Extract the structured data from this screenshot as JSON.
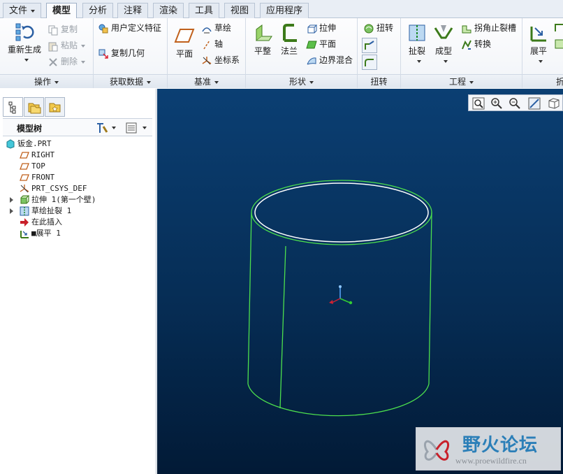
{
  "tabs": [
    {
      "label": "文件",
      "has_menu": true
    },
    {
      "label": "模型",
      "active": true
    },
    {
      "label": "分析"
    },
    {
      "label": "注释"
    },
    {
      "label": "渲染"
    },
    {
      "label": "工具"
    },
    {
      "label": "视图"
    },
    {
      "label": "应用程序"
    }
  ],
  "ribbon": {
    "operations": {
      "footer": "操作",
      "regenerate": "重新生成",
      "copy": "复制",
      "paste": "粘贴",
      "delete": "删除"
    },
    "get_data": {
      "footer": "获取数据",
      "user_defined_feature": "用户定义特征",
      "copy_geometry": "复制几何"
    },
    "datum": {
      "footer": "基准",
      "plane": "平面",
      "sketch": "草绘",
      "axis": "轴",
      "csys": "坐标系"
    },
    "shapes": {
      "footer": "形状",
      "flat": "平整",
      "flange": "法兰",
      "extrude": "拉伸",
      "planar": "平面",
      "boundary_blend": "边界混合"
    },
    "twist": {
      "footer": "扭转",
      "twist": "扭转"
    },
    "engineering": {
      "footer": "工程",
      "rip": "扯裂",
      "form": "成型",
      "corner_relief": "拐角止裂槽",
      "convert": "转换"
    },
    "bends": {
      "footer": "折",
      "unbend": "展平"
    }
  },
  "model_tree": {
    "title": "模型树",
    "items": [
      {
        "label": "钣金.PRT",
        "icon": "part-icon"
      },
      {
        "label": "RIGHT",
        "icon": "datum-plane-icon"
      },
      {
        "label": "TOP",
        "icon": "datum-plane-icon"
      },
      {
        "label": "FRONT",
        "icon": "datum-plane-icon"
      },
      {
        "label": "PRT_CSYS_DEF",
        "icon": "csys-icon"
      },
      {
        "label": "拉伸 1(第一个壁)",
        "icon": "extrude-wall-icon",
        "expandable": true
      },
      {
        "label": "草绘扯裂 1",
        "icon": "sketched-rip-icon",
        "expandable": true
      },
      {
        "label": "在此插入",
        "icon": "insert-here-arrow-icon"
      },
      {
        "label": "■展平 1",
        "icon": "unbend-icon"
      }
    ]
  },
  "watermark": {
    "title": "野火论坛",
    "url": "www.proewildfire.cn"
  },
  "colors": {
    "accent": "#2b5fa3",
    "viewport_top": "#0b3f73",
    "viewport_bottom": "#021a36",
    "model_edge": "#3fdc3f"
  }
}
